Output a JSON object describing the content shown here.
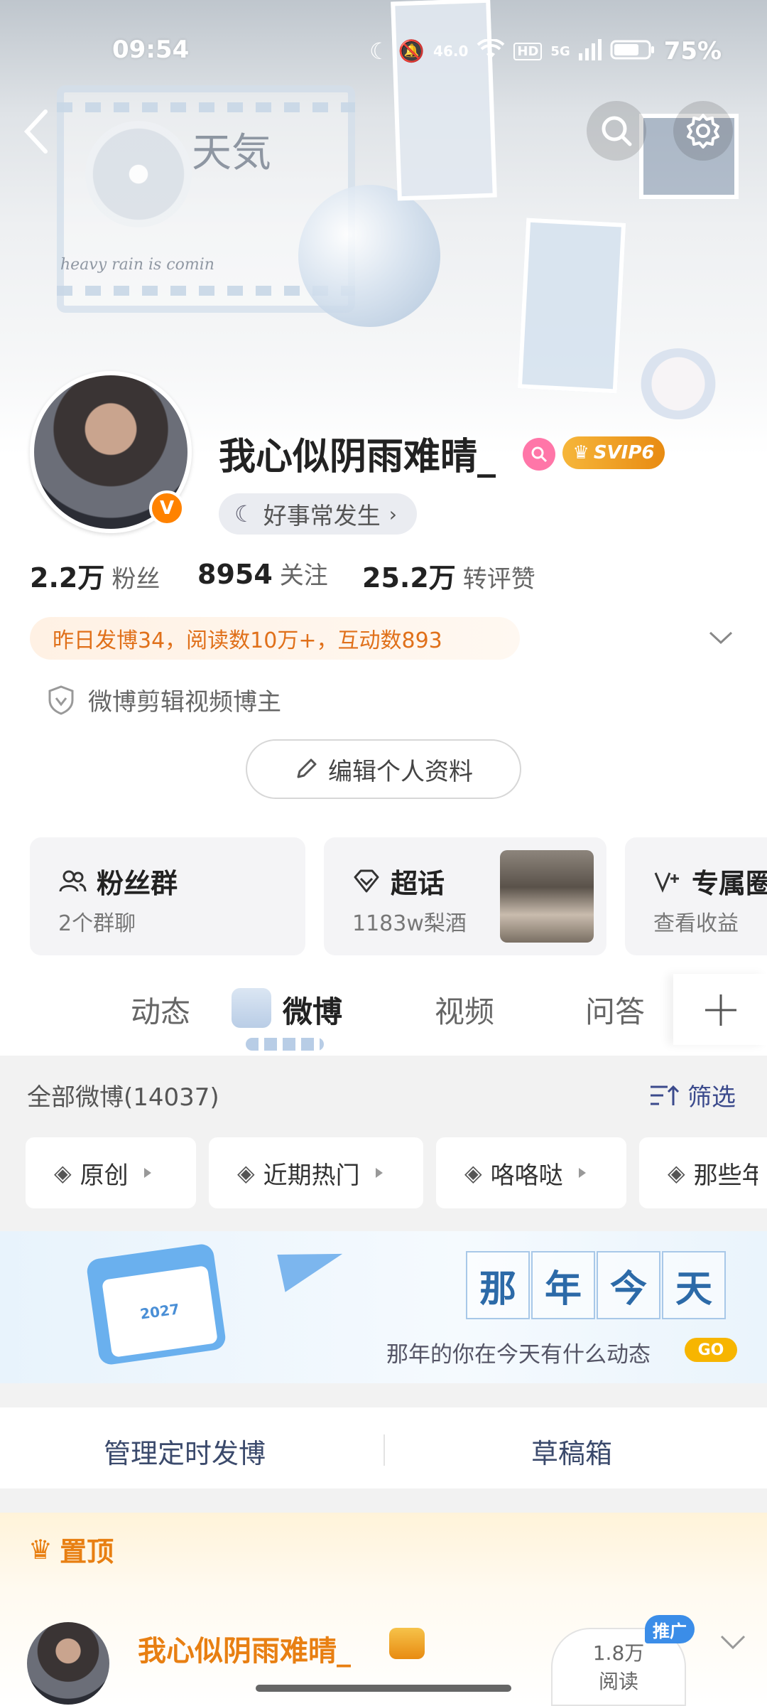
{
  "status_bar": {
    "time": "09:54",
    "network": "46.0",
    "hd": "HD",
    "signal_label": "5G",
    "battery": "75%"
  },
  "banner": {
    "title": "天気",
    "subtitle": "heavy rain is comin"
  },
  "profile": {
    "name": "我心似阴雨难晴_",
    "vip": "SVIP6",
    "verified_mark": "V",
    "signature": "好事常发生",
    "stats": [
      {
        "value": "2.2万",
        "label": "粉丝"
      },
      {
        "value": "8954",
        "label": "关注"
      },
      {
        "value": "25.2万",
        "label": "转评赞"
      }
    ],
    "daily_summary": "昨日发博34，阅读数10万+，互动数893",
    "certification": "微博剪辑视频博主",
    "edit_button": "编辑个人资料"
  },
  "cards": [
    {
      "title": "粉丝群",
      "sub": "2个群聊",
      "icon": "people-icon"
    },
    {
      "title": "超话",
      "sub": "1183w梨酒",
      "icon": "diamond-icon"
    },
    {
      "title": "专属圈",
      "sub": "查看收益",
      "icon": "v-plus-icon"
    }
  ],
  "tabs": [
    "动态",
    "微博",
    "视频",
    "问答"
  ],
  "active_tab": "微博",
  "feed": {
    "header": "全部微博(14037)",
    "filter": "筛选",
    "chips": [
      "原创",
      "近期热门",
      "咯咯哒",
      "那些年"
    ]
  },
  "promo_banner": {
    "calendar_year": "2027",
    "chars": [
      "那",
      "年",
      "今",
      "天"
    ],
    "subtitle": "那年的你在今天有什么动态",
    "go": "GO"
  },
  "manage": {
    "scheduled": "管理定时发博",
    "drafts": "草稿箱"
  },
  "pinned": {
    "label": "置顶",
    "name": "我心似阴雨难晴_",
    "reads": "1.8万",
    "reads_label": "阅读",
    "promo": "推广"
  }
}
